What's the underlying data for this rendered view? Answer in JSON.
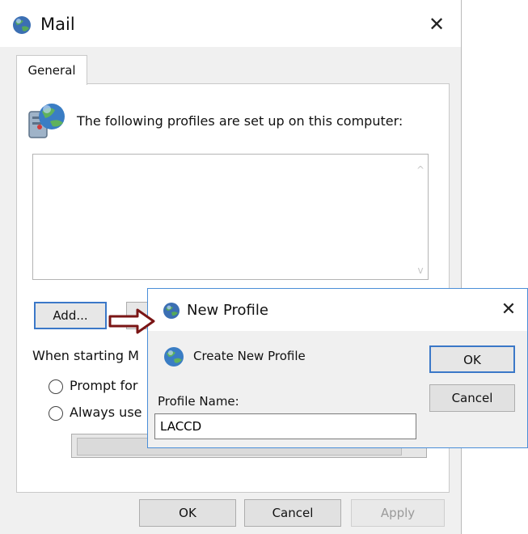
{
  "mail_dialog": {
    "title": "Mail",
    "tabs": [
      {
        "label": "General"
      }
    ],
    "heading": "The following profiles are set up on this computer:",
    "profiles": [],
    "add_button": "Add...",
    "when_starting": "When starting M",
    "radio_prompt": "Prompt for",
    "radio_always": "Always use",
    "ok_button": "OK",
    "cancel_button": "Cancel",
    "apply_button": "Apply"
  },
  "new_profile_dialog": {
    "title": "New Profile",
    "subtitle": "Create New Profile",
    "ok_button": "OK",
    "cancel_button": "Cancel",
    "profile_name_label": "Profile Name:",
    "profile_name_value": "LACCD"
  },
  "colors": {
    "focus_border": "#3b78c8",
    "arrow": "#7a1515",
    "dialog_bg": "#f0f0f0"
  }
}
